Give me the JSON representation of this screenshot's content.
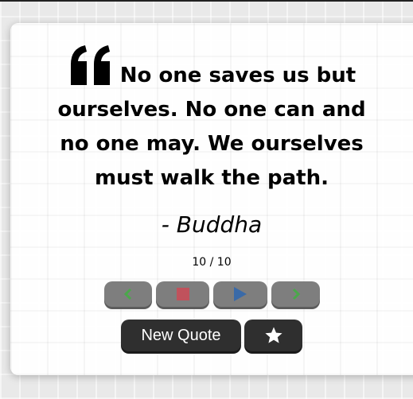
{
  "quote": {
    "text": "No one saves us but ourselves. No one can and no one may. We ourselves must walk the path.",
    "author": "- Buddha"
  },
  "counter": "10 / 10",
  "controls": {
    "prev": "chevron-left-icon",
    "stop": "stop-icon",
    "play": "play-icon",
    "next": "chevron-right-icon"
  },
  "buttons": {
    "new_quote": "New Quote",
    "favorite": "star-icon"
  },
  "colors": {
    "control_bg": "#7e7e7e",
    "prev_next_icon": "#4aa84a",
    "stop_icon": "#c0525c",
    "play_icon": "#3a6aa8",
    "dark_button": "#2f2f2f"
  }
}
